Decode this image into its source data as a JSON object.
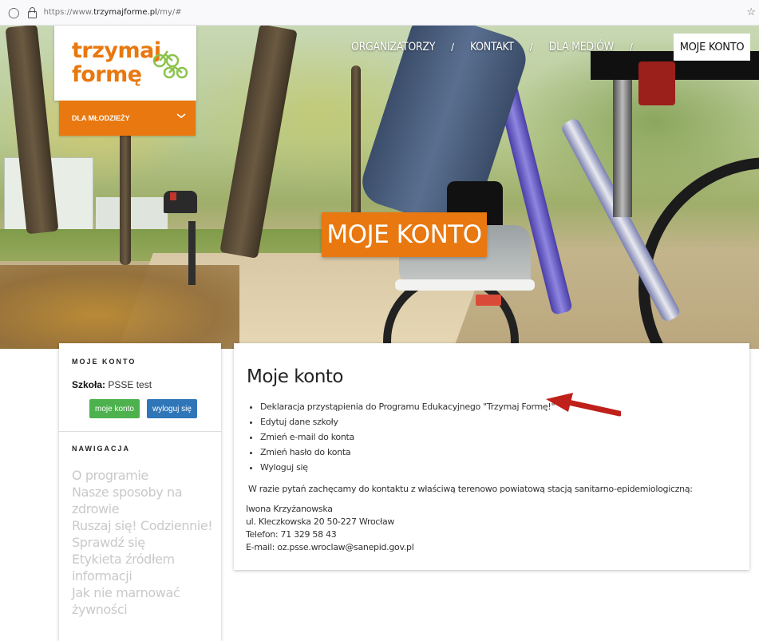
{
  "browser": {
    "url_prefix": "https://www.",
    "url_domain": "trzymajforme.pl",
    "url_path": "/my/#"
  },
  "logo": {
    "line1": "trzymaj",
    "line2": "formę"
  },
  "dropdown": {
    "label": "DLA MŁODZIEŻY"
  },
  "nav": {
    "items": [
      "ORGANIZATORZY",
      "KONTAKT",
      "DLA MEDIÓW"
    ],
    "separator": "/",
    "active": "MOJE KONTO"
  },
  "hero": {
    "title": "MOJE KONTO"
  },
  "sidebar": {
    "account_heading": "MOJE KONTO",
    "school_label": "Szkoła:",
    "school_value": "PSSE test",
    "my_account_button": "moje konto",
    "logout_button": "wyloguj się",
    "nav_heading": "NAWIGACJA",
    "nav_items": [
      "O programie",
      "Nasze sposoby na",
      "zdrowie",
      "Ruszaj się! Codziennie!",
      "Sprawdź się",
      "Etykieta źródłem",
      "informacji",
      "Jak nie marnować",
      "żywności"
    ]
  },
  "main": {
    "title": "Moje konto",
    "links": [
      "Deklaracja przystąpienia do Programu Edukacyjnego \"Trzymaj Formę!\"",
      "Edytuj dane szkoły",
      "Zmień e-mail do konta",
      "Zmień hasło do konta",
      "Wyloguj się"
    ],
    "info": "W razie pytań zachęcamy do kontaktu z właściwą terenowo powiatową stacją sanitarno-epidemiologiczną:",
    "contact": [
      "Iwona Krzyżanowska",
      "ul. Kleczkowska 20 50-227 Wrocław",
      "Telefon: 71 329 58 43",
      "E-mail: oz.psse.wroclaw@sanepid.gov.pl"
    ]
  },
  "colors": {
    "brand_orange": "#e8780f",
    "button_green": "#4db24d",
    "button_blue": "#2f76b8",
    "annotation_arrow": "#c0201a"
  }
}
